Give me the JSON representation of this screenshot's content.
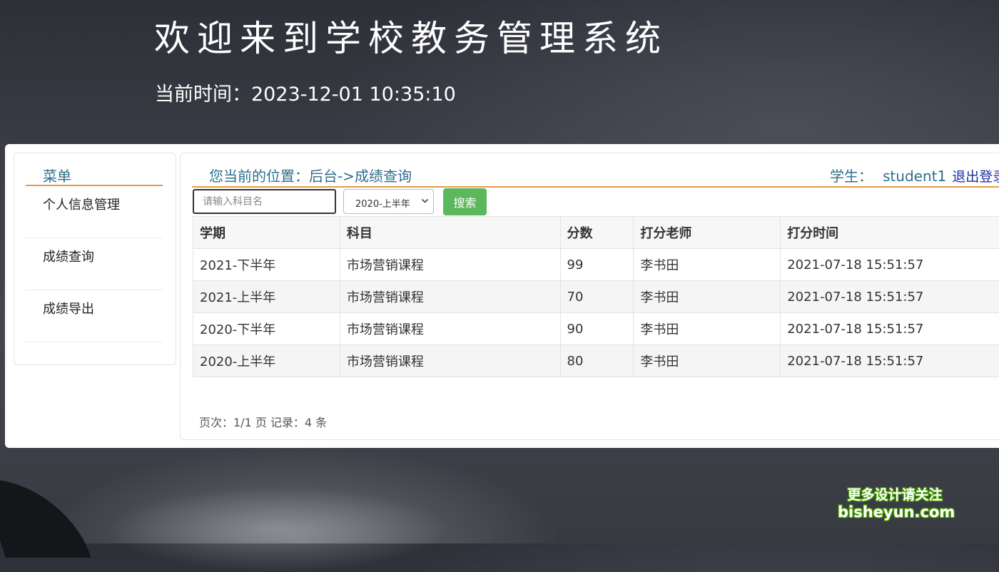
{
  "header": {
    "title": "欢迎来到学校教务管理系统",
    "time_label": "当前时间：",
    "time_value": "2023-12-01 10:35:10"
  },
  "menu": {
    "title": "菜单",
    "items": [
      {
        "label": "个人信息管理"
      },
      {
        "label": "成绩查询"
      },
      {
        "label": "成绩导出"
      }
    ]
  },
  "content": {
    "breadcrumb": "您当前的位置：后台->成绩查询",
    "user_role": "学生：",
    "username": "student1",
    "logout": "退出登录"
  },
  "search": {
    "placeholder": "请输入科目名",
    "value": "",
    "term_selected": "2020-上半年",
    "button": "搜索"
  },
  "table": {
    "headers": [
      "学期",
      "科目",
      "分数",
      "打分老师",
      "打分时间"
    ],
    "rows": [
      [
        "2021-下半年",
        "市场营销课程",
        "99",
        "李书田",
        "2021-07-18 15:51:57"
      ],
      [
        "2021-上半年",
        "市场营销课程",
        "70",
        "李书田",
        "2021-07-18 15:51:57"
      ],
      [
        "2020-下半年",
        "市场营销课程",
        "90",
        "李书田",
        "2021-07-18 15:51:57"
      ],
      [
        "2020-上半年",
        "市场营销课程",
        "80",
        "李书田",
        "2021-07-18 15:51:57"
      ]
    ]
  },
  "pagination": {
    "text": "页次：1/1 页 记录：4 条"
  },
  "watermark": {
    "line1": "更多设计请关注",
    "line2": "bisheyun.com"
  },
  "colors": {
    "accent_line": "#e09a4c",
    "link_text": "#2f6e8c",
    "search_button": "#5cb85c"
  }
}
